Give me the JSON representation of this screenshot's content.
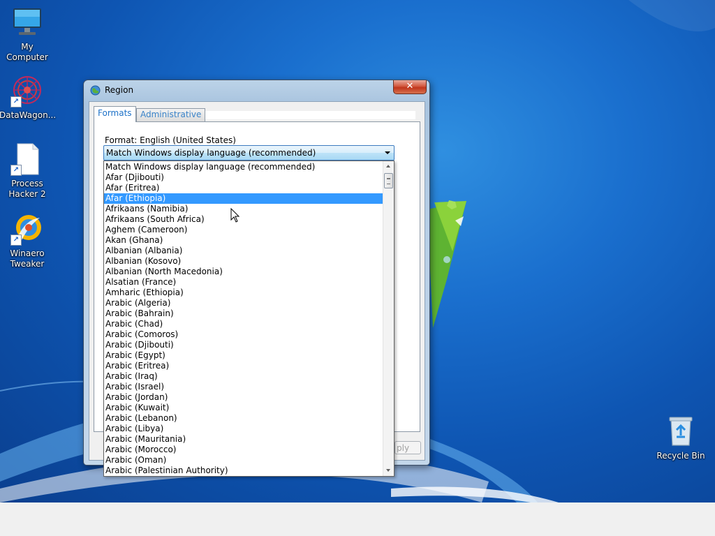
{
  "desktop": {
    "icons": [
      {
        "label": "My Computer",
        "icon": "computer-icon"
      },
      {
        "label": "DataWagon...",
        "icon": "datawagon-icon"
      },
      {
        "label": "Process Hacker 2",
        "icon": "document-icon"
      },
      {
        "label": "Winaero Tweaker",
        "icon": "winaero-tweaker-icon"
      },
      {
        "label": "Recycle Bin",
        "icon": "recycle-bin-icon"
      }
    ]
  },
  "dialog": {
    "title": "Region",
    "close_glyph": "✕",
    "tabs": [
      {
        "label": "Formats",
        "active": true
      },
      {
        "label": "Administrative",
        "active": false
      }
    ],
    "format_label": "Format: English (United States)",
    "format_value": "Match Windows display language (recommended)",
    "apply_label": "ply"
  },
  "dropdown": {
    "selected_index": 3,
    "items": [
      "Match Windows display language (recommended)",
      "Afar (Djibouti)",
      "Afar (Eritrea)",
      "Afar (Ethiopia)",
      "Afrikaans (Namibia)",
      "Afrikaans (South Africa)",
      "Aghem (Cameroon)",
      "Akan (Ghana)",
      "Albanian (Albania)",
      "Albanian (Kosovo)",
      "Albanian (North Macedonia)",
      "Alsatian (France)",
      "Amharic (Ethiopia)",
      "Arabic (Algeria)",
      "Arabic (Bahrain)",
      "Arabic (Chad)",
      "Arabic (Comoros)",
      "Arabic (Djibouti)",
      "Arabic (Egypt)",
      "Arabic (Eritrea)",
      "Arabic (Iraq)",
      "Arabic (Israel)",
      "Arabic (Jordan)",
      "Arabic (Kuwait)",
      "Arabic (Lebanon)",
      "Arabic (Libya)",
      "Arabic (Mauritania)",
      "Arabic (Morocco)",
      "Arabic (Oman)",
      "Arabic (Palestinian Authority)"
    ]
  },
  "colors": {
    "desktop_blue": "#1a6fce",
    "selection": "#3399ff",
    "tab_text": "#1e72c8"
  }
}
